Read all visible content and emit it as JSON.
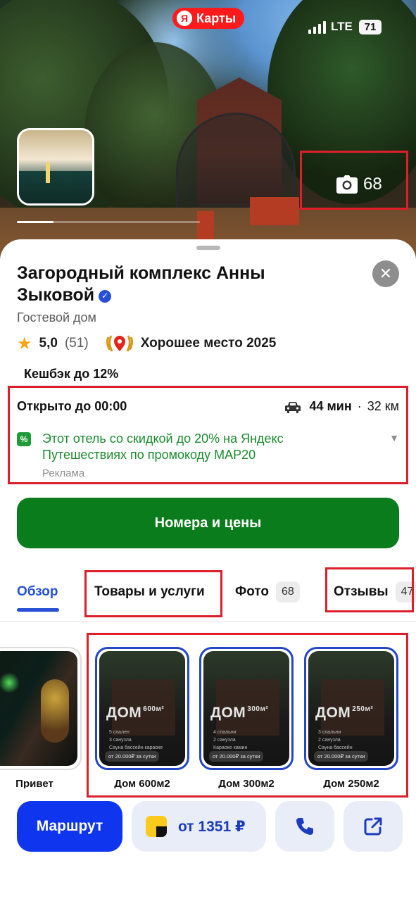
{
  "status_bar": {
    "network": "LTE",
    "battery": "71"
  },
  "header": {
    "app_name": "Карты",
    "brand_mark": "Я"
  },
  "hero": {
    "photo_count": "68"
  },
  "place": {
    "title": "Загородный комплекс Анны Зыковой",
    "category": "Гостевой дом",
    "rating": "5,0",
    "reviews_count": "(51)",
    "award": "Хорошее место 2025",
    "cashback": "Кешбэк до 12%",
    "hours": "Открыто до 00:00",
    "drive_time": "44 мин",
    "separator": "·",
    "distance": "32 км",
    "ad_text": "Этот отель со скидкой до 20% на Яндекс Путешествиях по промокоду MAP20",
    "ad_label": "Реклама",
    "rooms_button": "Номера и цены"
  },
  "tabs": [
    {
      "label": "Обзор",
      "active": true
    },
    {
      "label": "Товары и услуги"
    },
    {
      "label": "Фото",
      "badge": "68"
    },
    {
      "label": "Отзывы",
      "badge": "47"
    }
  ],
  "goods": [
    {
      "caption": "Привет",
      "badge": "",
      "size": "",
      "amenities": "",
      "price": ""
    },
    {
      "caption": "Дом 600м2",
      "badge": "ДОМ",
      "size": "600м²",
      "amenities": "5 спален\n3 санузла\nСауна бассейн караоке",
      "price": "от 20.000₽ за сутки"
    },
    {
      "caption": "Дом 300м2",
      "badge": "ДОМ",
      "size": "300м²",
      "amenities": "4 спальни\n2 санузла\nКараоке камин",
      "price": "от 20.000₽ за сутки"
    },
    {
      "caption": "Дом 250м2",
      "badge": "ДОМ",
      "size": "250м²",
      "amenities": "3 спальни\n2 санузла\nСауна бассейн",
      "price": "от 20.000₽ за сутки"
    }
  ],
  "actions": {
    "route": "Маршрут",
    "price": "от 1351 ₽"
  },
  "colors": {
    "accent_blue": "#0f35ef",
    "green_button": "#0b7c1b",
    "ad_green": "#1c8b2f",
    "annotation_red": "#dc1f2a",
    "star": "#f7a618"
  },
  "icons": [
    "camera-icon",
    "close-icon",
    "star-icon",
    "award-icon",
    "car-icon",
    "percent-icon",
    "chevron-down-icon",
    "pay-icon",
    "phone-icon",
    "share-icon",
    "verified-icon"
  ]
}
